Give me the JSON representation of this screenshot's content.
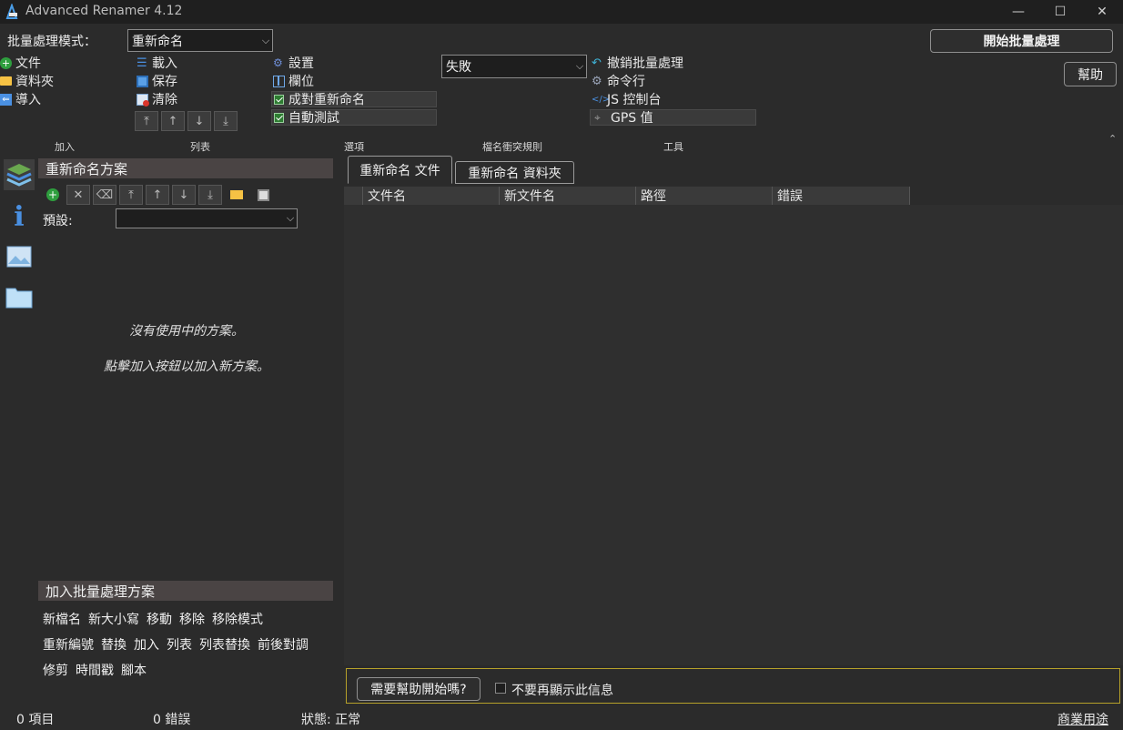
{
  "window": {
    "title": "Advanced Renamer 4.12",
    "minimize": "—",
    "maximize": "☐",
    "close": "✕"
  },
  "toolbar": {
    "batch_mode_label": "批量處理模式：",
    "batch_mode_value": "重新命名",
    "start_button": "開始批量處理",
    "help_button": "幫助",
    "add": {
      "file": "文件",
      "folder": "資料夾",
      "import": "導入",
      "section": "加入"
    },
    "list": {
      "load": "載入",
      "save": "保存",
      "clear": "清除",
      "section": "列表"
    },
    "options": {
      "settings": "設置",
      "columns": "欄位",
      "pair_rename": "成對重新命名",
      "auto_test": "自動測試",
      "section": "選項"
    },
    "conflict": {
      "value": "失敗",
      "section": "檔名衝突規則"
    },
    "tools": {
      "undo": "撤銷批量處理",
      "command_line": "命令行",
      "js_console": "JS 控制台",
      "gps": "GPS 值",
      "section": "工具"
    }
  },
  "left_panel": {
    "header": "重新命名方案",
    "preset_label": "預設:",
    "preset_value": "",
    "empty_line1": "沒有使用中的方案。",
    "empty_line2": "點擊加入按鈕以加入新方案。",
    "add_methods_header": "加入批量處理方案",
    "methods_row1": [
      "新檔名",
      "新大小寫",
      "移動",
      "移除",
      "移除模式"
    ],
    "methods_row2": [
      "重新編號",
      "替換",
      "加入",
      "列表",
      "列表替換",
      "前後對調"
    ],
    "methods_row3": [
      "修剪",
      "時間戳",
      "腳本"
    ]
  },
  "tabs": {
    "files": "重新命名 文件",
    "folders": "重新命名 資料夾"
  },
  "grid": {
    "columns": [
      "文件名",
      "新文件名",
      "路徑",
      "錯誤"
    ]
  },
  "helpbar": {
    "button": "需要幫助開始嗎?",
    "checkbox_label": "不要再顯示此信息"
  },
  "status": {
    "items": "0 項目",
    "errors": "0 錯誤",
    "state": "狀態: 正常",
    "commercial": "商業用途"
  },
  "colors": {
    "accent_green": "#2e9e3e",
    "folder_yellow": "#f6c244",
    "blue": "#4a90e2",
    "help_border": "#b6a12a"
  }
}
